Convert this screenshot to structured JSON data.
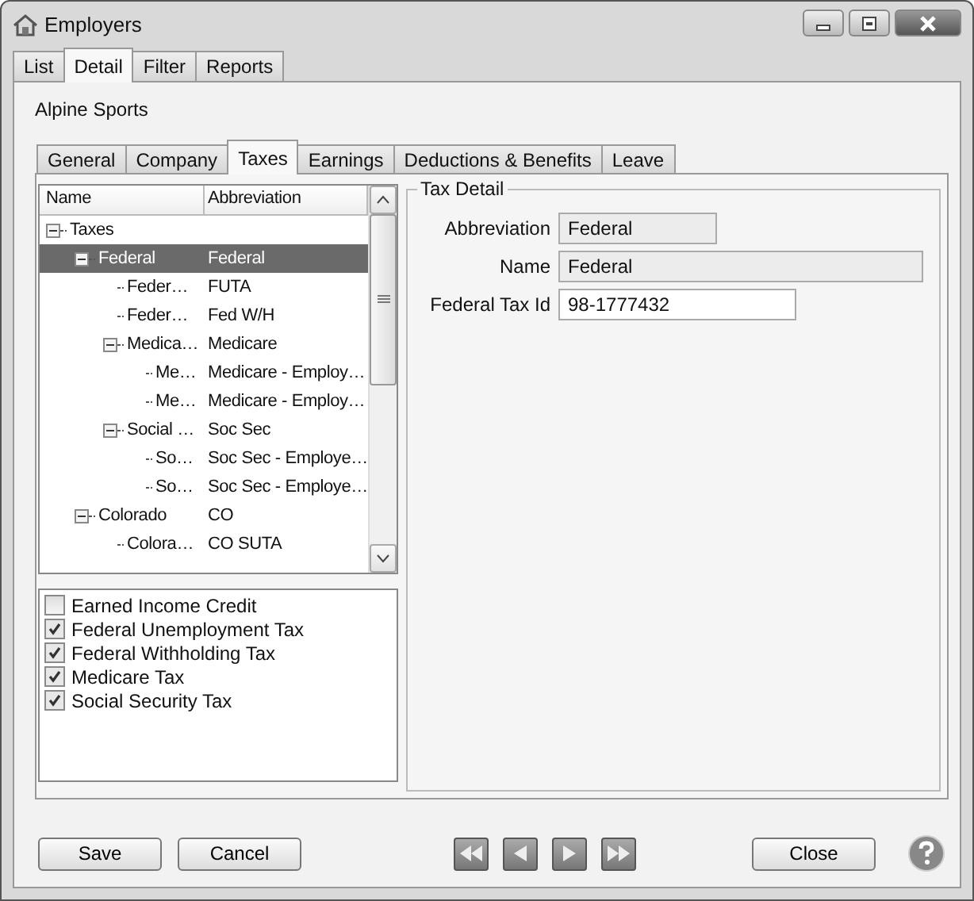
{
  "window": {
    "title": "Employers"
  },
  "tabs": [
    {
      "label": "List",
      "selected": false
    },
    {
      "label": "Detail",
      "selected": true
    },
    {
      "label": "Filter",
      "selected": false
    },
    {
      "label": "Reports",
      "selected": false
    }
  ],
  "employer_name": "Alpine Sports",
  "sub_tabs": [
    {
      "label": "General",
      "selected": false
    },
    {
      "label": "Company",
      "selected": false
    },
    {
      "label": "Taxes",
      "selected": true
    },
    {
      "label": "Earnings",
      "selected": false
    },
    {
      "label": "Deductions & Benefits",
      "selected": false
    },
    {
      "label": "Leave",
      "selected": false
    }
  ],
  "tree": {
    "columns": [
      "Name",
      "Abbreviation"
    ],
    "nodes": [
      {
        "name": "Taxes",
        "expanded": true,
        "selected": false,
        "children": [
          {
            "name": "Federal",
            "abbreviation": "Federal",
            "expanded": true,
            "selected": true,
            "children": [
              {
                "name": "Feder…",
                "abbreviation": "FUTA",
                "selected": false
              },
              {
                "name": "Feder…",
                "abbreviation": "Fed W/H",
                "selected": false
              },
              {
                "name": "Medica…",
                "abbreviation": "Medicare",
                "expanded": true,
                "selected": false,
                "children": [
                  {
                    "name": "Me…",
                    "abbreviation": "Medicare - Employ…",
                    "selected": false
                  },
                  {
                    "name": "Me…",
                    "abbreviation": "Medicare - Employ…",
                    "selected": false
                  }
                ]
              },
              {
                "name": "Social …",
                "abbreviation": "Soc Sec",
                "expanded": true,
                "selected": false,
                "children": [
                  {
                    "name": "So…",
                    "abbreviation": "Soc Sec - Employe…",
                    "selected": false
                  },
                  {
                    "name": "So…",
                    "abbreviation": "Soc Sec - Employe…",
                    "selected": false
                  }
                ]
              }
            ]
          },
          {
            "name": "Colorado",
            "abbreviation": "CO",
            "expanded": true,
            "selected": false,
            "children": [
              {
                "name": "Colora…",
                "abbreviation": "CO SUTA",
                "selected": false
              }
            ]
          }
        ]
      }
    ]
  },
  "tax_checklist": [
    {
      "label": "Earned Income Credit",
      "checked": false
    },
    {
      "label": "Federal Unemployment Tax",
      "checked": true
    },
    {
      "label": "Federal Withholding Tax",
      "checked": true
    },
    {
      "label": "Medicare Tax",
      "checked": true
    },
    {
      "label": "Social Security Tax",
      "checked": true
    }
  ],
  "tax_detail": {
    "title": "Tax Detail",
    "fields": [
      {
        "label": "Abbreviation",
        "value": "Federal",
        "disabled": true
      },
      {
        "label": "Name",
        "value": "Federal",
        "disabled": true
      },
      {
        "label": "Federal Tax Id",
        "value": "98-1777432",
        "disabled": false
      }
    ]
  },
  "buttons": {
    "save": "Save",
    "cancel": "Cancel",
    "close": "Close"
  }
}
